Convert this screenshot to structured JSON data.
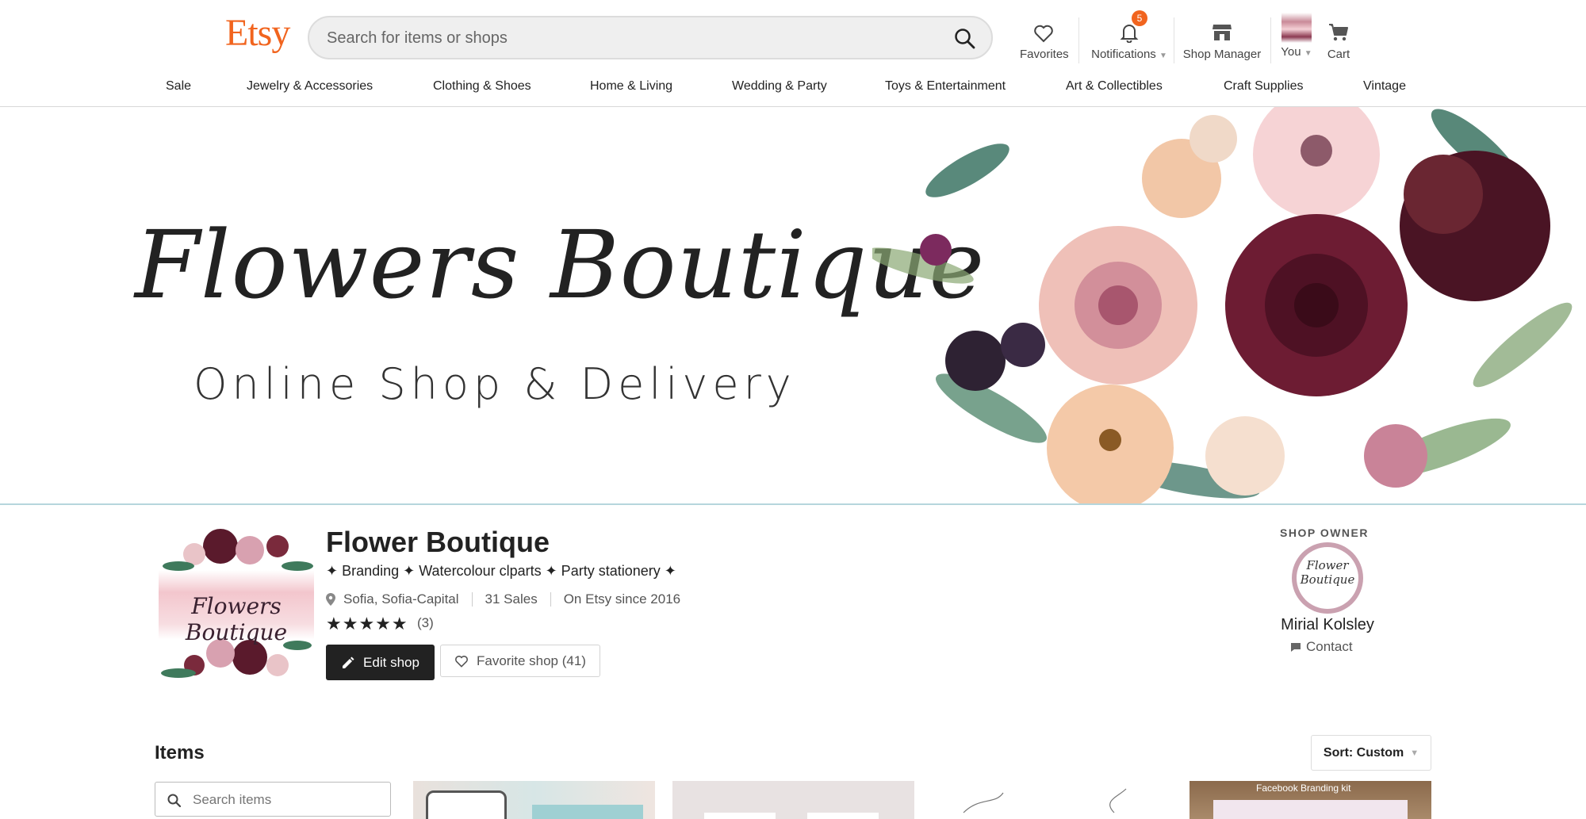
{
  "header": {
    "logo": "Etsy",
    "search_placeholder": "Search for items or shops",
    "nav": {
      "favorites": "Favorites",
      "notifications": "Notifications",
      "notifications_badge": "5",
      "shop_manager": "Shop Manager",
      "you": "You",
      "cart": "Cart"
    },
    "accent_color": "#f1641e"
  },
  "categories": [
    "Sale",
    "Jewelry & Accessories",
    "Clothing & Shoes",
    "Home & Living",
    "Wedding & Party",
    "Toys & Entertainment",
    "Art & Collectibles",
    "Craft Supplies",
    "Vintage"
  ],
  "banner": {
    "title": "Flowers Boutique",
    "subtitle": "Online Shop & Delivery"
  },
  "shop": {
    "logo_text": "Flowers Boutique",
    "name": "Flower Boutique",
    "tagline": "✦ Branding ✦ Watercolour clparts ✦ Party stationery ✦",
    "location": "Sofia, Sofia-Capital",
    "sales": "31 Sales",
    "since": "On Etsy since 2016",
    "rating": 5,
    "stars": "★★★★★",
    "review_count": "(3)",
    "edit_label": "Edit shop",
    "favorite_label": "Favorite shop (41)"
  },
  "owner": {
    "label": "SHOP OWNER",
    "avatar_text": "Flower Boutique",
    "name": "Mirial Kolsley",
    "contact_label": "Contact"
  },
  "items": {
    "title": "Items",
    "sort_label": "Sort: Custom",
    "search_placeholder": "Search items",
    "thumb4_label": "Facebook Branding kit"
  }
}
